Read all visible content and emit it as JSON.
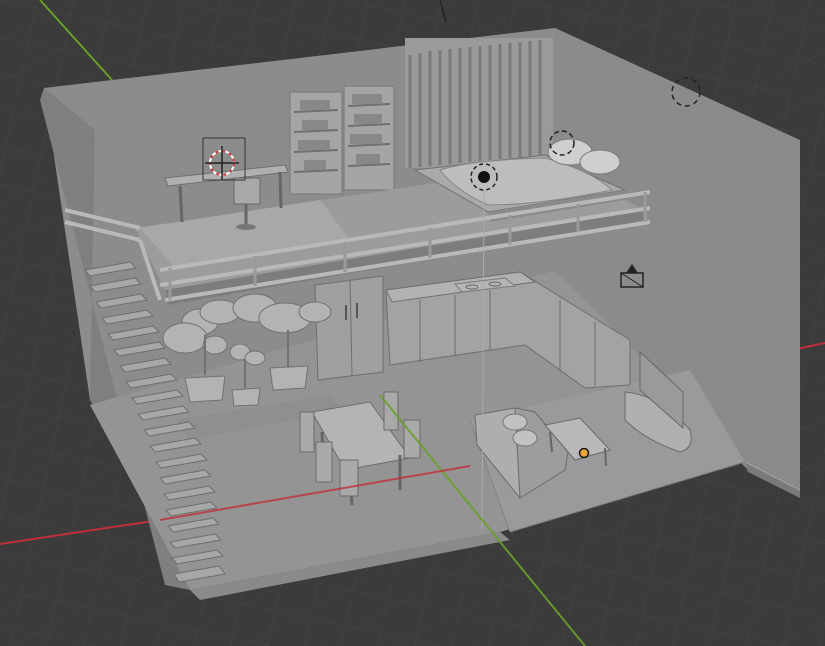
{
  "viewport": {
    "background": "#3b3b3b",
    "grid_color": "#454545",
    "x_axis_color": "#c0303c",
    "y_axis_color": "#6aa02a"
  },
  "scene": {
    "room_color": "#8c8c8c",
    "floor_color": "#939393",
    "wall_left_color": "#8a8a8a",
    "wall_right_color": "#7c7c7c",
    "origin_color": "#f2a23c",
    "cursor_color": "#d23c3c",
    "objects": [
      "loft-room",
      "stairs",
      "bookshelves",
      "curtain",
      "desk",
      "office-chair",
      "bed",
      "pillows",
      "railing",
      "kitchen-cabinets",
      "refrigerator",
      "stove",
      "potted-trees",
      "dining-table",
      "dining-chairs",
      "sofa",
      "coffee-table",
      "tv-stand",
      "television"
    ],
    "gizmos": [
      "point-light",
      "spot-light",
      "area-light",
      "camera",
      "3d-cursor",
      "object-origin"
    ]
  }
}
